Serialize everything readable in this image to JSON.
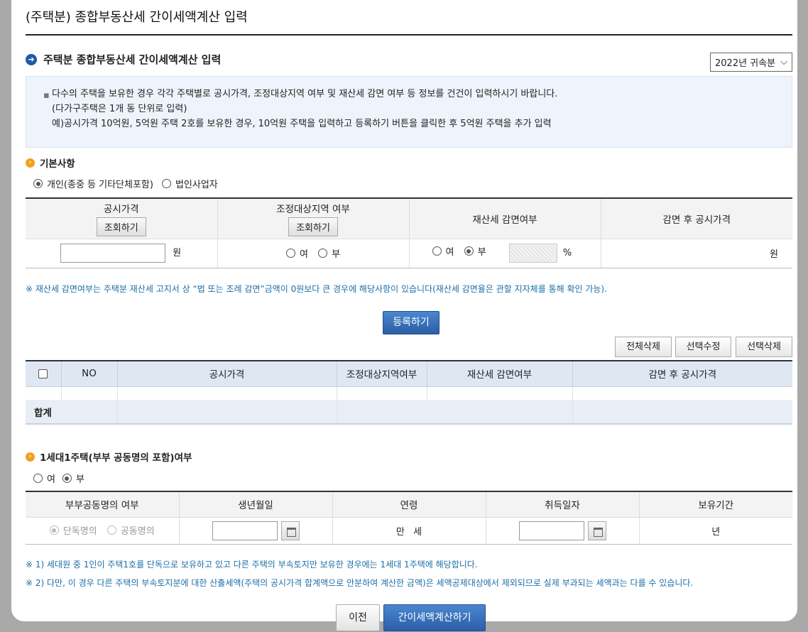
{
  "dialog_title": "(주택분) 종합부동산세 간이세액계산 입력",
  "section": {
    "title": "주택분 종합부동산세 간이세액계산 입력",
    "year_select": "2022년 귀속분"
  },
  "notice": [
    "다수의 주택을 보유한 경우 각각 주택별로 공시가격, 조정대상지역 여부 및 재산세 감면 여부 등 정보를 건건이 입력하시기 바랍니다.",
    "(다가구주택은 1개 동 단위로 입력)",
    "예)공시가격 10억원, 5억원 주택 2호를 보유한 경우, 10억원 주택을 입력하고 등록하기 버튼을 클릭한 후 5억원 주택을 추가 입력"
  ],
  "basic": {
    "title": "기본사항",
    "opt_individual": "개인(종중 등 기타단체포함)",
    "opt_corp": "법인사업자"
  },
  "input_table": {
    "col_price": "공시가격",
    "col_adj": "조정대상지역 여부",
    "col_reduce": "재산세 감면여부",
    "col_after": "감면 후 공시가격",
    "lookup_btn": "조회하기",
    "won": "원",
    "yes": "여",
    "no": "부",
    "percent": "%"
  },
  "note1": "※ 재산세 감면여부는 주택분 재산세 고지서 상 “법 또는 조례 감면”금액이 0원보다 큰 경우에 해당사항이 있습니다(재산세 감면율은 관할 지자체를 통해 확인 가능).",
  "register_btn": "등록하기",
  "actions": {
    "delete_all": "전체삭제",
    "edit_selected": "선택수정",
    "delete_selected": "선택삭제"
  },
  "list_table": {
    "col_no": "NO",
    "col_price": "공시가격",
    "col_adj": "조정대상지역여부",
    "col_reduce": "재산세 감면여부",
    "col_after": "감면 후 공시가격",
    "sum_label": "합계"
  },
  "one_house": {
    "title": "1세대1주택(부부 공동명의 포함)여부",
    "yes": "여",
    "no": "부"
  },
  "owner_table": {
    "col_joint": "부부공동명의 여부",
    "col_birth": "생년월일",
    "col_age": "연령",
    "col_acq": "취득일자",
    "col_hold": "보유기간",
    "opt_single": "단독명의",
    "opt_joint": "공동명의",
    "age_unit": "만   세",
    "year_unit": "년"
  },
  "note2": "※ 1) 세대원 중 1인이 주택1호를 단독으로 보유하고 있고 다른 주택의 부속토지만 보유한 경우에는 1세대 1주택에 해당합니다.",
  "note3": "※ 2) 다만, 이 경우 다른 주택의 부속토지분에 대한 산출세액(주택의 공시가격 합계액으로 안분하여 계산한 금액)은 세액공제대상에서 제외되므로 실제 부과되는 세액과는 다를 수 있습니다.",
  "prev_btn": "이전",
  "calc_btn": "간이세액계산하기"
}
